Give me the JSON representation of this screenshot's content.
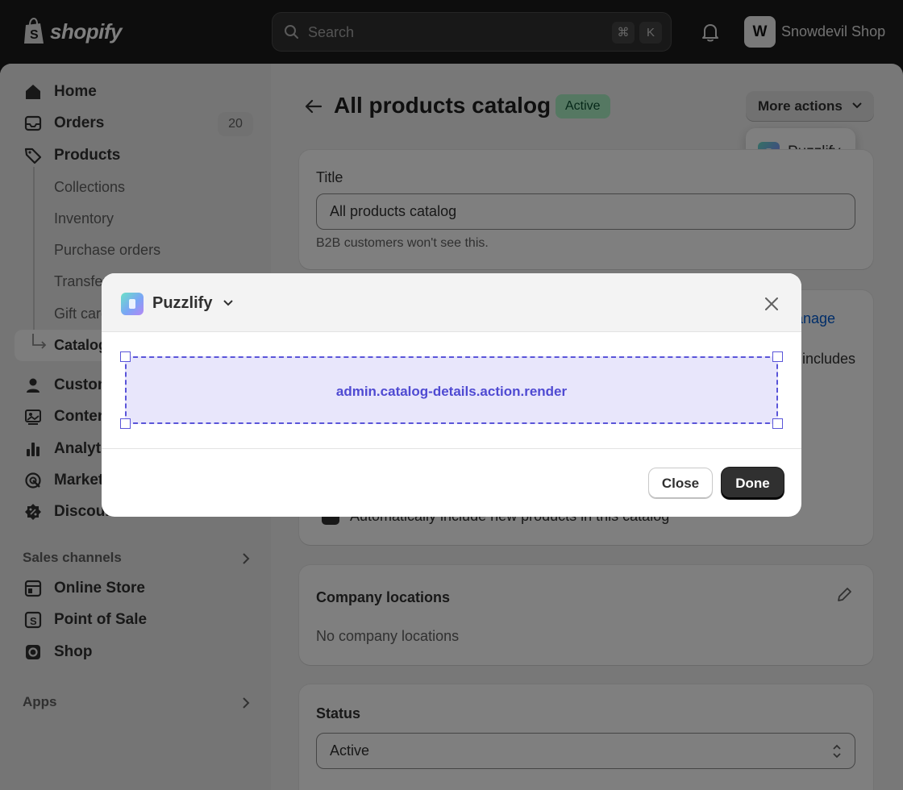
{
  "topbar": {
    "logo_text": "shopify",
    "search_placeholder": "Search",
    "shortcut_keys": [
      "⌘",
      "K"
    ],
    "store_name": "Snowdevil Shop",
    "store_avatar": "W"
  },
  "sidebar": {
    "items": [
      {
        "label": "Home",
        "icon": "home-icon"
      },
      {
        "label": "Orders",
        "icon": "inbox-icon",
        "count": "20"
      },
      {
        "label": "Products",
        "icon": "tag-icon"
      }
    ],
    "product_subitems": [
      "Collections",
      "Inventory",
      "Purchase orders",
      "Transfers",
      "Gift cards"
    ],
    "selected_subitem": "Catalogs",
    "more_items": [
      {
        "label": "Customers",
        "icon": "person-icon"
      },
      {
        "label": "Content",
        "icon": "image-icon"
      },
      {
        "label": "Analytics",
        "icon": "bar-chart-icon"
      },
      {
        "label": "Marketing",
        "icon": "target-icon"
      },
      {
        "label": "Discounts",
        "icon": "discount-icon"
      }
    ],
    "sales_channels_heading": "Sales channels",
    "channels": [
      {
        "label": "Online Store",
        "icon": "store-icon"
      },
      {
        "label": "Point of Sale",
        "icon": "pos-icon"
      },
      {
        "label": "Shop",
        "icon": "shop-icon"
      }
    ],
    "apps_heading": "Apps"
  },
  "page": {
    "title": "All products catalog",
    "status": "Active",
    "more_actions_label": "More actions",
    "popover_item": "Puzzlify"
  },
  "title_card": {
    "label": "Title",
    "value": "All products catalog",
    "help": "B2B customers won't see this."
  },
  "products_card": {
    "manage_link": "Manage",
    "partial_text": "includes",
    "checkbox_label": "Automatically include new products in this catalog"
  },
  "locations_card": {
    "heading": "Company locations",
    "empty_text": "No company locations"
  },
  "status_card": {
    "heading": "Status",
    "selected": "Active"
  },
  "modal": {
    "title": "Puzzlify",
    "extension_target": "admin.catalog-details.action.render",
    "close_label": "Close",
    "done_label": "Done"
  }
}
